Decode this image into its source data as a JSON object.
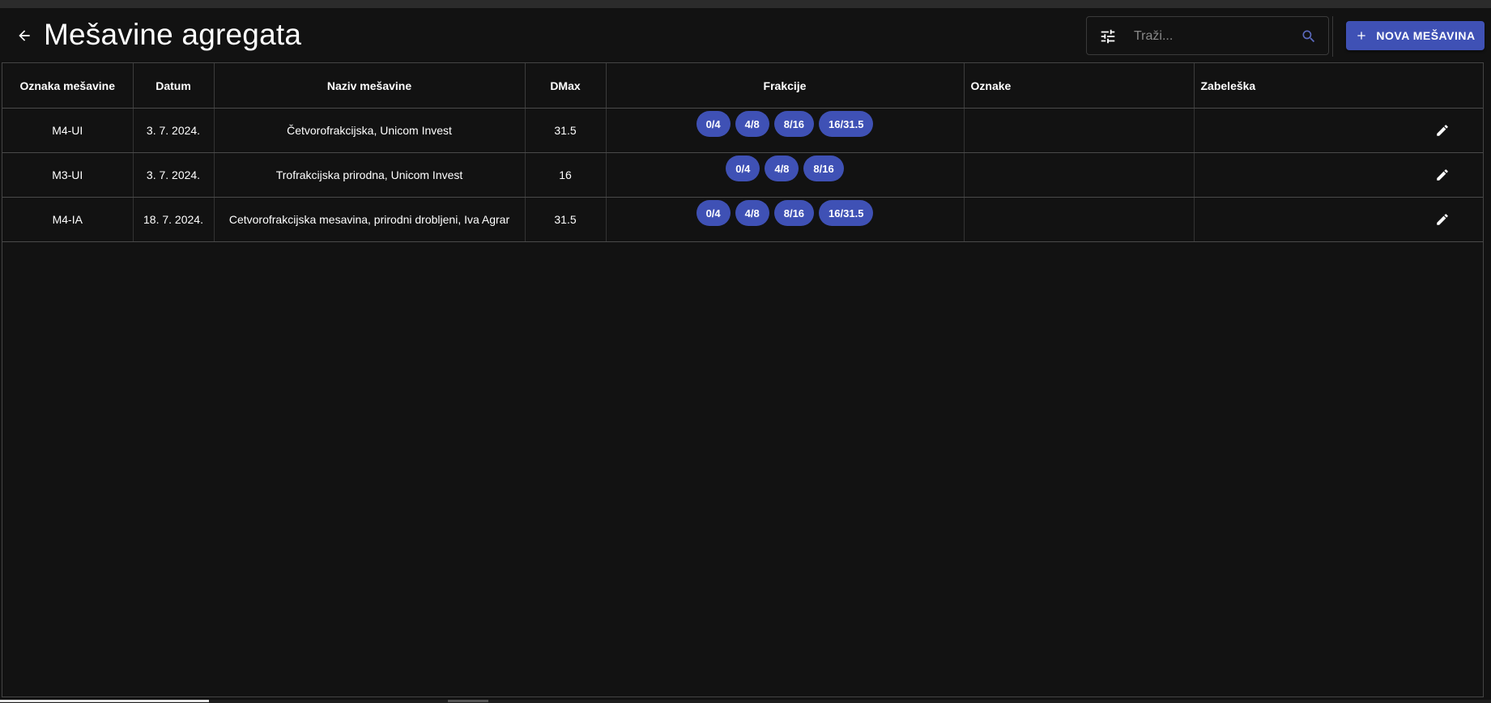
{
  "header": {
    "title": "Mešavine agregata",
    "back_icon": "arrow-back-icon"
  },
  "search": {
    "placeholder": "Traži...",
    "value": "",
    "filter_icon": "tune-icon",
    "search_icon": "search-icon"
  },
  "toolbar": {
    "new_label": "NOVA MEŠAVINA",
    "new_icon": "plus-icon"
  },
  "colors": {
    "background": "#121212",
    "accent": "#3f51b5",
    "search_icon": "#5c6bc0"
  },
  "table": {
    "columns": [
      "Oznaka mešavine",
      "Datum",
      "Naziv mešavine",
      "DMax",
      "Frakcije",
      "Oznake",
      "Zabeleška"
    ],
    "rows": [
      {
        "oznaka": "M4-UI",
        "datum": "3. 7. 2024.",
        "naziv": "Četvorofrakcijska, Unicom Invest",
        "dmax": "31.5",
        "frakcije": [
          "0/4",
          "4/8",
          "8/16",
          "16/31.5"
        ],
        "oznake": "",
        "zabeleska": ""
      },
      {
        "oznaka": "M3-UI",
        "datum": "3. 7. 2024.",
        "naziv": "Trofrakcijska prirodna, Unicom Invest",
        "dmax": "16",
        "frakcije": [
          "0/4",
          "4/8",
          "8/16"
        ],
        "oznake": "",
        "zabeleska": ""
      },
      {
        "oznaka": "M4-IA",
        "datum": "18. 7. 2024.",
        "naziv": "Cetvorofrakcijska mesavina, prirodni drobljeni, Iva Agrar",
        "dmax": "31.5",
        "frakcije": [
          "0/4",
          "4/8",
          "8/16",
          "16/31.5"
        ],
        "oznake": "",
        "zabeleska": ""
      }
    ],
    "row_action_icon": "edit-icon"
  }
}
